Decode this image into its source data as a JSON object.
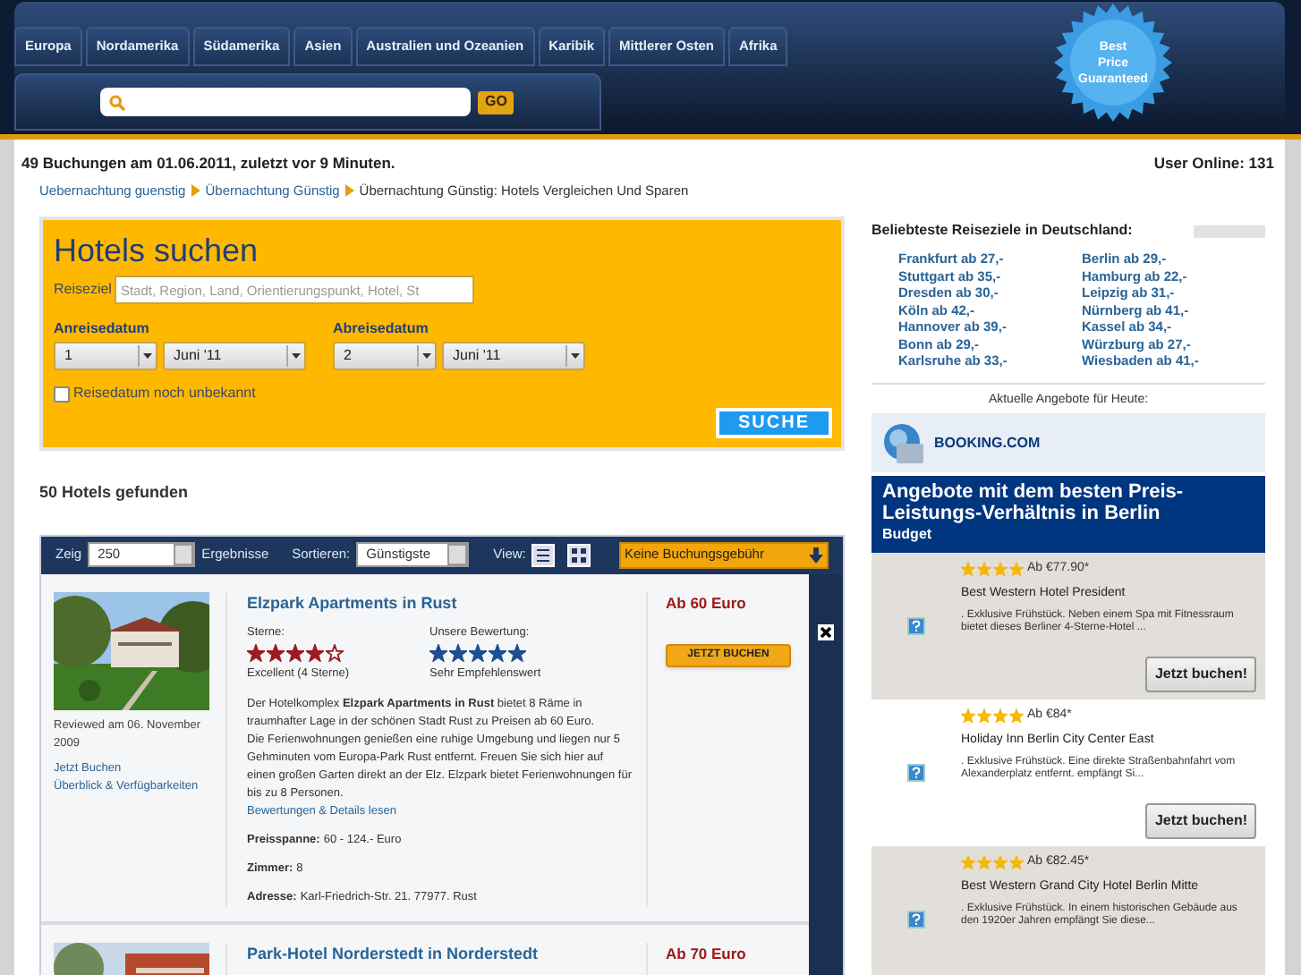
{
  "nav": {
    "items": [
      "Europa",
      "Nordamerika",
      "Südamerika",
      "Asien",
      "Australien und Ozeanien",
      "Karibik",
      "Mittlerer Osten",
      "Afrika"
    ]
  },
  "search_bar": {
    "button": "GO"
  },
  "badge": {
    "lines": [
      "Best",
      "Price",
      "Guaranteed"
    ]
  },
  "info": {
    "bookings": "49 Buchungen am 01.06.2011, zuletzt vor 9 Minuten.",
    "user_online": "User Online: 131"
  },
  "breadcrumb": [
    {
      "kind": "link",
      "label": "Uebernachtung guenstig"
    },
    {
      "kind": "link",
      "label": "Übernachtung Günstig"
    },
    {
      "kind": "current",
      "label": "Übernachtung Günstig: Hotels Vergleichen Und Sparen"
    }
  ],
  "hotel_search": {
    "title": "Hotels suchen",
    "destination_label": "Reiseziel",
    "destination_placeholder": "Stadt, Region, Land, Orientierungspunkt, Hotel, St",
    "arrival_label": "Anreisedatum",
    "arrival_day": "1",
    "arrival_month": "Juni '11",
    "departure_label": "Abreisedatum",
    "departure_day": "2",
    "departure_month": "Juni '11",
    "date_unknown": {
      "label": "Reisedatum noch unbekannt",
      "checked": false
    },
    "submit": "SUCHE"
  },
  "results_count": "50 Hotels gefunden",
  "toolbar": {
    "show_label": "Zeig",
    "show_value": "250",
    "results_label": "Ergebnisse",
    "sort_label": "Sortieren:",
    "sort_value": "Günstigste",
    "view_label": "View:",
    "fee_button": "Keine Buchungsgebühr"
  },
  "hotels": [
    {
      "name": "Elzpark Apartments in Rust",
      "price": "Ab 60 Euro",
      "reviewed": "Reviewed am 06. November 2009",
      "links": [
        "Jetzt Buchen",
        "Überblick & Verfügbarkeiten"
      ],
      "stars_label": "Sterne:",
      "hotel_stars": {
        "stars": 4
      },
      "stars_text": "Excellent (4 Sterne)",
      "rating_label": "Unsere Bewertung:",
      "rating": {
        "stars": 5
      },
      "rating_text": "Sehr Empfehlenswert",
      "paragraphs": [
        "Der Hotelkomplex **Elzpark Apartments in Rust** bietet 8 Räme in traumhafter Lage in der schönen Stadt Rust zu Preisen ab 60 Euro.",
        "Die Ferienwohnungen genießen eine ruhige Umgebung und liegen nur 5 Gehminuten vom Europa-Park Rust entfernt. Freuen Sie sich hier auf einen großen Garten direkt an der Elz. Elzpark bietet Ferienwohnungen für bis zu 8 Personen."
      ],
      "details_link": "Bewertungen & Details lesen",
      "facts": [
        {
          "label": "Preisspanne:",
          "value": "60 - 124.- Euro"
        },
        {
          "label": "Zimmer:",
          "value": "8"
        },
        {
          "label": "Adresse:",
          "value": "Karl-Friedrich-Str. 21. 77977. Rust"
        }
      ],
      "book_button": "JETZT BUCHEN"
    },
    {
      "name": "Park-Hotel Norderstedt in Norderstedt",
      "price": "Ab 70 Euro"
    }
  ],
  "popular": {
    "title": "Beliebteste Reiseziele in Deutschland:",
    "columns": [
      [
        "Frankfurt ab 27,-",
        "Stuttgart ab 35,-",
        "Dresden ab 30,-",
        "Köln ab 42,-",
        "Hannover ab 39,-",
        "Bonn ab 29,-",
        "Karlsruhe ab 33,-"
      ],
      [
        "Berlin ab 29,-",
        "Hamburg ab 22,-",
        "Leipzig ab 31,-",
        "Nürnberg ab 41,-",
        "Kassel ab 34,-",
        "Würzburg ab 27,-",
        "Wiesbaden ab 41,-"
      ]
    ]
  },
  "offers": {
    "heading": "Aktuelle Angebote für Heute:",
    "provider": "BOOKING.COM",
    "banner_title": "Angebote mit dem besten Preis-Leistungs-Verhältnis in Berlin",
    "banner_subtitle": "Budget",
    "items": [
      {
        "stars": 4,
        "price": "Ab €77.90*",
        "name": "Best Western Hotel President",
        "description": ". Exklusive Frühstück. Neben einem Spa mit Fitnessraum bietet dieses Berliner 4-Sterne-Hotel ...",
        "button": "Jetzt buchen!"
      },
      {
        "stars": 4,
        "price": "Ab €84*",
        "name": "Holiday Inn Berlin City Center East",
        "description": ". Exklusive Frühstück. Eine direkte Straßenbahnfahrt vom Alexanderplatz entfernt. empfängt Si...",
        "button": "Jetzt buchen!"
      },
      {
        "stars": 4,
        "price": "Ab €82.45*",
        "name": "Best Western Grand City Hotel Berlin Mitte",
        "description": ". Exklusive Frühstück. In einem historischen Gebäude aus den 1920er Jahren empfängt Sie diese..."
      }
    ]
  }
}
